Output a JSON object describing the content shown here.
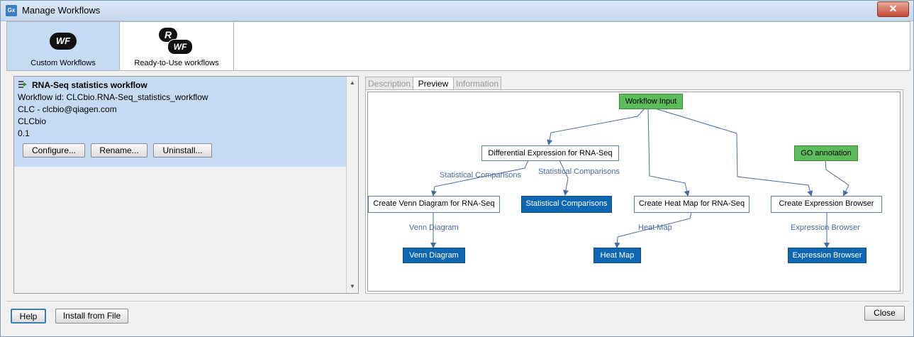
{
  "window": {
    "title": "Manage Workflows",
    "app_icon": "Gx",
    "close_glyph": "✕"
  },
  "toolbar": {
    "custom": {
      "label": "Custom Workflows",
      "icon_text": "WF"
    },
    "ready": {
      "label": "Ready-to-Use workflows",
      "icon_r": "R",
      "icon_wf": "WF"
    }
  },
  "workflow": {
    "title": "RNA-Seq statistics workflow",
    "id_line": "Workflow id: CLCbio.RNA-Seq_statistics_workflow",
    "author_line": "CLC - clcbio@qiagen.com",
    "vendor": "CLCbio",
    "version": "0.1",
    "buttons": {
      "configure": "Configure...",
      "rename": "Rename...",
      "uninstall": "Uninstall..."
    }
  },
  "scroll": {
    "up": "▲",
    "down": "▼"
  },
  "tabs": {
    "description": "Description",
    "preview": "Preview",
    "information": "Information"
  },
  "diagram": {
    "workflow_input": "Workflow Input",
    "diff_expr": "Differential Expression for RNA-Seq",
    "go_annotation": "GO annotation",
    "venn_create": "Create Venn Diagram for RNA-Seq",
    "stat_comp": "Statistical Comparisons",
    "heatmap_create": "Create Heat Map for RNA-Seq",
    "expr_browser_create": "Create Expression Browser",
    "venn_out": "Venn Diagram",
    "heatmap_out": "Heat Map",
    "expr_browser_out": "Expression Browser",
    "label_stat_left": "Statistical Comparisons",
    "label_stat_right": "Statistical Comparisons",
    "label_venn": "Venn Diagram",
    "label_heat": "Heat Map",
    "label_browser": "Expression Browser"
  },
  "footer": {
    "help": "Help",
    "install": "Install from File",
    "close": "Close"
  },
  "colors": {
    "selected": "#c5dbf3",
    "input_node": "#5cbc5c",
    "output_node": "#0e67b3",
    "edge": "#4a6aa0"
  }
}
